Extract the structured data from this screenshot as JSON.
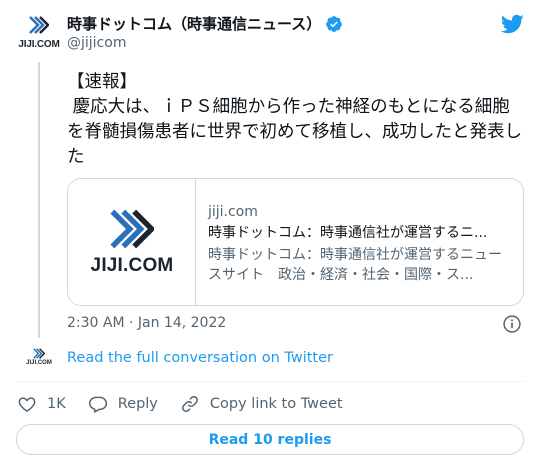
{
  "author": {
    "display_name": "時事ドットコム（時事通信ニュース）",
    "handle": "@jijicom",
    "avatar_logo_text": "JIJI.COM",
    "verified": true
  },
  "tweet": {
    "text": "【速報】\n 慶応大は、ｉＰＳ細胞から作った神経のもとになる細胞を脊髄損傷患者に世界で初めて移植し、成功したと発表した",
    "timestamp": "2:30 AM · Jan 14, 2022"
  },
  "card": {
    "thumb_logo_text": "JIJI.COM",
    "domain": "jiji.com",
    "title": "時事ドットコム：時事通信社が運営するニ...",
    "description": "時事ドットコム：時事通信社が運営するニュースサイト　政治・経済・社会・国際・ス..."
  },
  "conversation": {
    "logo_text": "JIJI.COM",
    "link_label": "Read the full conversation on Twitter"
  },
  "actions": {
    "like_count": "1K",
    "reply_label": "Reply",
    "copy_label": "Copy link to Tweet"
  },
  "read_replies_label": "Read 10 replies",
  "colors": {
    "accent": "#1d9bf0",
    "text": "#0f1419",
    "muted": "#536471",
    "border": "#cfd9de",
    "logo_blue": "#2a6fb8",
    "logo_dark": "#1c2430"
  }
}
